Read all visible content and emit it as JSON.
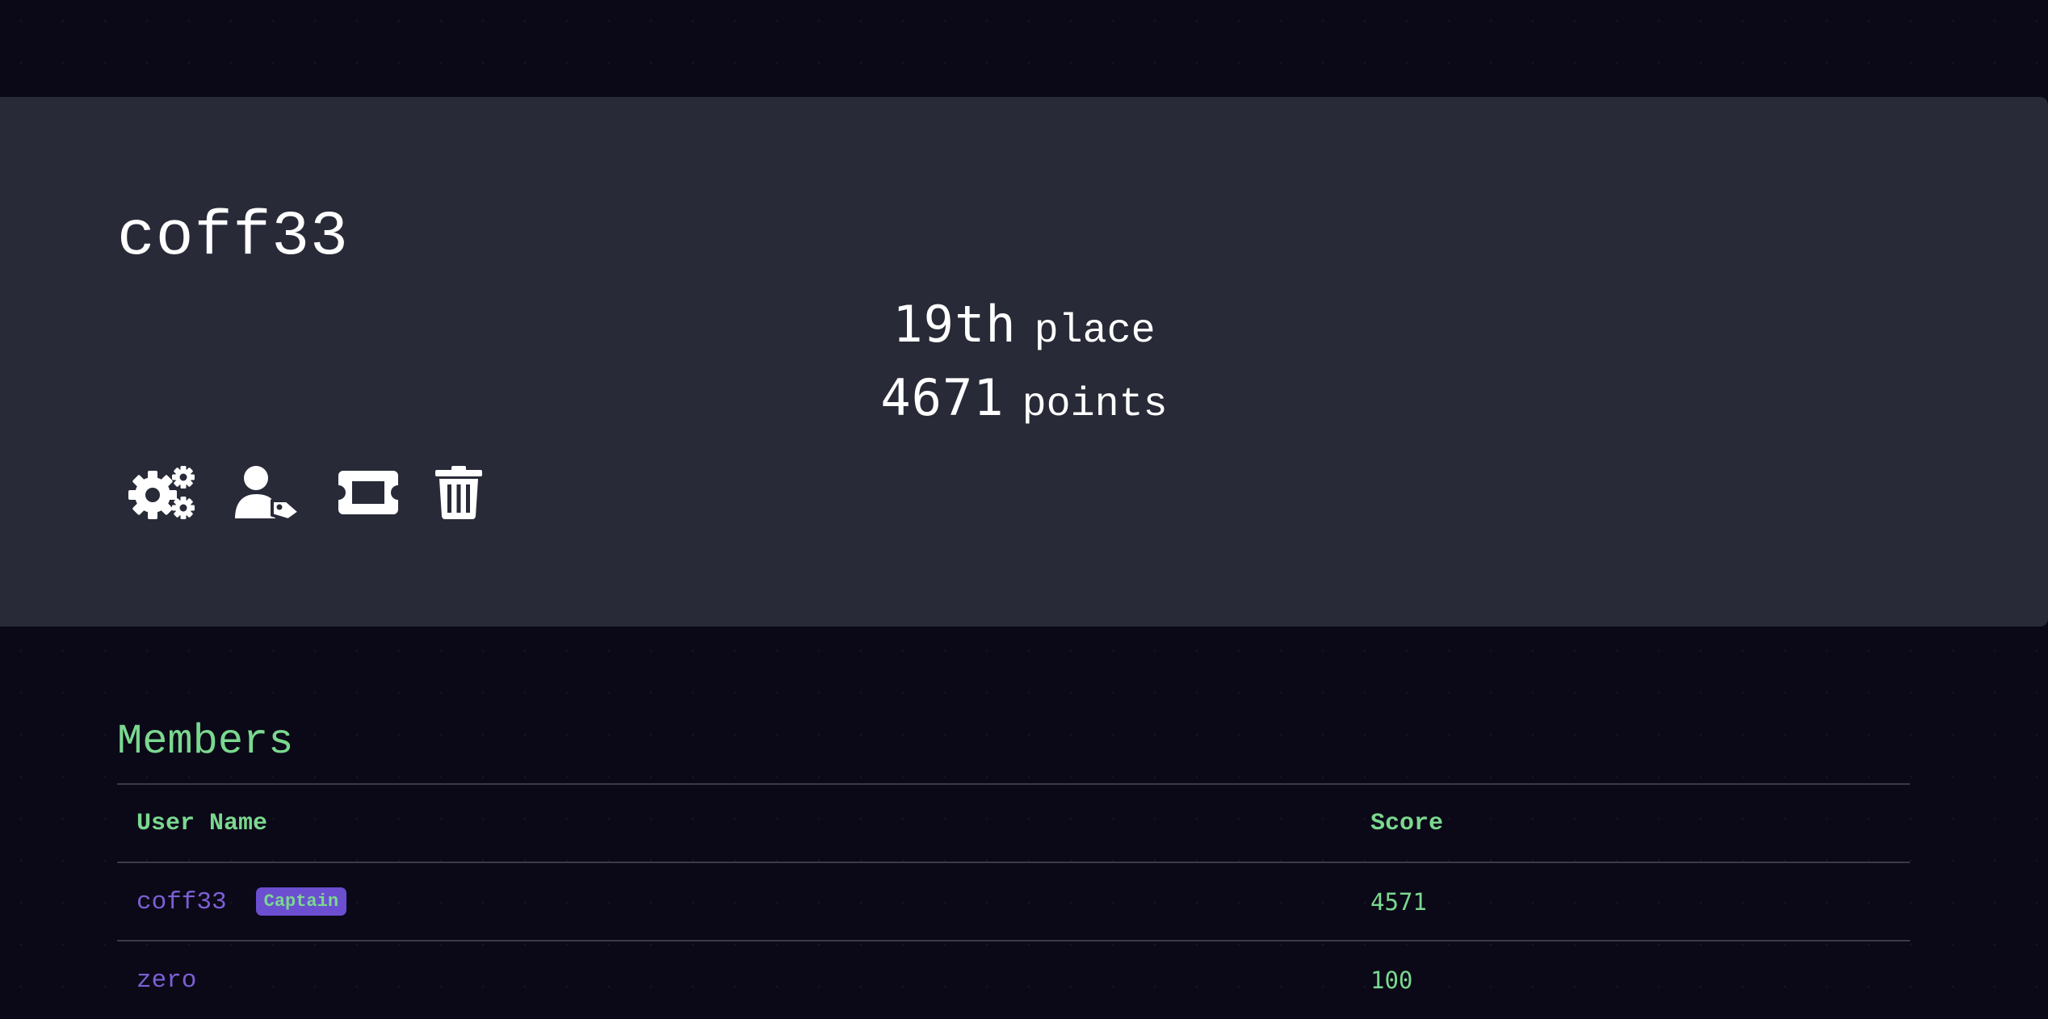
{
  "team": {
    "name": "coff33",
    "place_value": "19th",
    "place_unit": "place",
    "points_value": "4671",
    "points_unit": "points",
    "actions": [
      {
        "icon": "gears-icon",
        "label": "settings"
      },
      {
        "icon": "user-tag-icon",
        "label": "captain"
      },
      {
        "icon": "ticket-icon",
        "label": "invite"
      },
      {
        "icon": "trash-icon",
        "label": "delete"
      }
    ]
  },
  "members": {
    "title": "Members",
    "columns": [
      "User Name",
      "Score"
    ],
    "rows": [
      {
        "user": "coff33",
        "badge": "Captain",
        "score": "4571"
      },
      {
        "user": "zero",
        "badge": "",
        "score": "100"
      }
    ]
  },
  "colors": {
    "background": "#0b0918",
    "card": "#282a37",
    "accent_green": "#7bd88f",
    "accent_purple": "#7c5fd6",
    "badge_bg": "#6b4fd0"
  }
}
